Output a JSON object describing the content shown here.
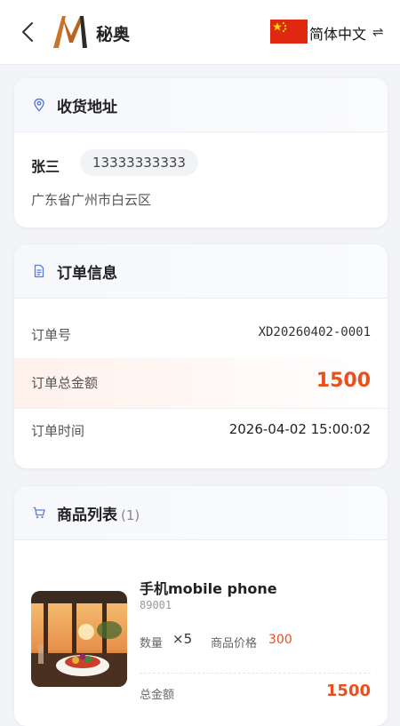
{
  "header": {
    "brand": "秘奥",
    "language": "简体中文",
    "swap_glyph": "⇌",
    "back_icon": "chevron-left-icon",
    "flag_icon": "china-flag-icon"
  },
  "address": {
    "title": "收货地址",
    "icon": "location-pin-icon",
    "name": "张三",
    "phone": "13333333333",
    "address": "广东省广州市白云区"
  },
  "order": {
    "title": "订单信息",
    "icon": "document-icon",
    "number_label": "订单号",
    "number": "XD20260402-0001",
    "total_label": "订单总金额",
    "total": "1500",
    "time_label": "订单时间",
    "time": "2026-04-02 15:00:02"
  },
  "products": {
    "title": "商品列表",
    "icon": "cart-icon",
    "count": "(1)",
    "items": [
      {
        "name": "手机mobile phone",
        "sku": "89001",
        "qty_label": "数量",
        "qty": "×5",
        "price_label": "商品价格",
        "price": "300",
        "total_label": "总金额",
        "total": "1500"
      }
    ]
  },
  "colors": {
    "accent": "#e8501f",
    "icon_blue": "#5a7bd8",
    "flag_red": "#de2910",
    "flag_yellow": "#ffde00"
  }
}
